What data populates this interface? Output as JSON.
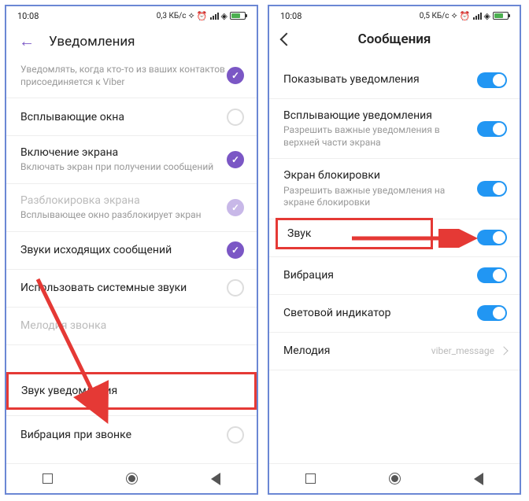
{
  "left": {
    "status": {
      "time": "10:08",
      "data_rate": "0,3 КБ/с"
    },
    "header": {
      "title": "Уведомления"
    },
    "items": [
      {
        "title": "",
        "sub": "Уведомлять, когда кто-то из ваших контактов присоединяется к Viber",
        "checked": true
      },
      {
        "title": "Всплывающие окна",
        "sub": "",
        "checked": false
      },
      {
        "title": "Включение экрана",
        "sub": "Включать экран при получении сообщений",
        "checked": true
      },
      {
        "title": "Разблокировка экрана",
        "sub": "Всплывающее окно разблокирует экран",
        "checked": true,
        "disabled": true,
        "faded": true
      },
      {
        "title": "Звуки исходящих сообщений",
        "sub": "",
        "checked": true
      },
      {
        "title": "Использовать системные звуки",
        "sub": "",
        "checked": false
      },
      {
        "title": "Мелодия звонка",
        "sub": "",
        "disabled": true,
        "no_control": true
      },
      {
        "title": "Звук уведомления",
        "sub": "",
        "highlight": true,
        "no_control": true
      },
      {
        "title": "Вибрация при звонке",
        "sub": "",
        "checked": false
      }
    ]
  },
  "right": {
    "status": {
      "time": "10:08",
      "data_rate": "0,5 КБ/с"
    },
    "header": {
      "title": "Сообщения"
    },
    "items": [
      {
        "title": "Показывать уведомления",
        "sub": "",
        "toggle": true
      },
      {
        "title": "Всплывающие уведомления",
        "sub": "Разрешить важные уведомления в верхней части экрана",
        "toggle": true
      },
      {
        "title": "Экран блокировки",
        "sub": "Разрешить важные уведомления на экране блокировки",
        "toggle": true
      },
      {
        "title": "Звук",
        "sub": "",
        "toggle": true,
        "highlight": true
      },
      {
        "title": "Вибрация",
        "sub": "",
        "toggle": true
      },
      {
        "title": "Световой индикатор",
        "sub": "",
        "toggle": true
      },
      {
        "title": "Мелодия",
        "sub": "",
        "value": "viber_message",
        "link": true
      }
    ]
  }
}
